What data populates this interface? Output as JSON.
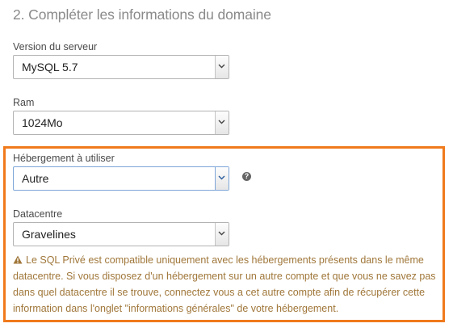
{
  "section": {
    "title": "2. Compléter les informations du domaine"
  },
  "fields": {
    "server_version": {
      "label": "Version du serveur",
      "value": "MySQL 5.7"
    },
    "ram": {
      "label": "Ram",
      "value": "1024Mo"
    },
    "hosting": {
      "label": "Hébergement à utiliser",
      "value": "Autre"
    },
    "datacenter": {
      "label": "Datacentre",
      "value": "Gravelines"
    }
  },
  "help": {
    "glyph": "?"
  },
  "warning": {
    "text": "Le SQL Privé est compatible uniquement avec les hébergements présents dans le même datacentre. Si vous disposez d'un hébergement sur un autre compte et que vous ne savez pas dans quel datacentre il se trouve, connectez vous a cet autre compte afin de récupérer cette information dans l'onglet \"informations générales\" de votre hébergement."
  },
  "colors": {
    "highlight_border": "#f07a1c",
    "warning_text": "#a0773a",
    "title_text": "#8a8a8a",
    "focus_border": "#7ea6d8"
  },
  "icons": [
    "chevron-down-icon",
    "help-icon",
    "warning-icon"
  ]
}
